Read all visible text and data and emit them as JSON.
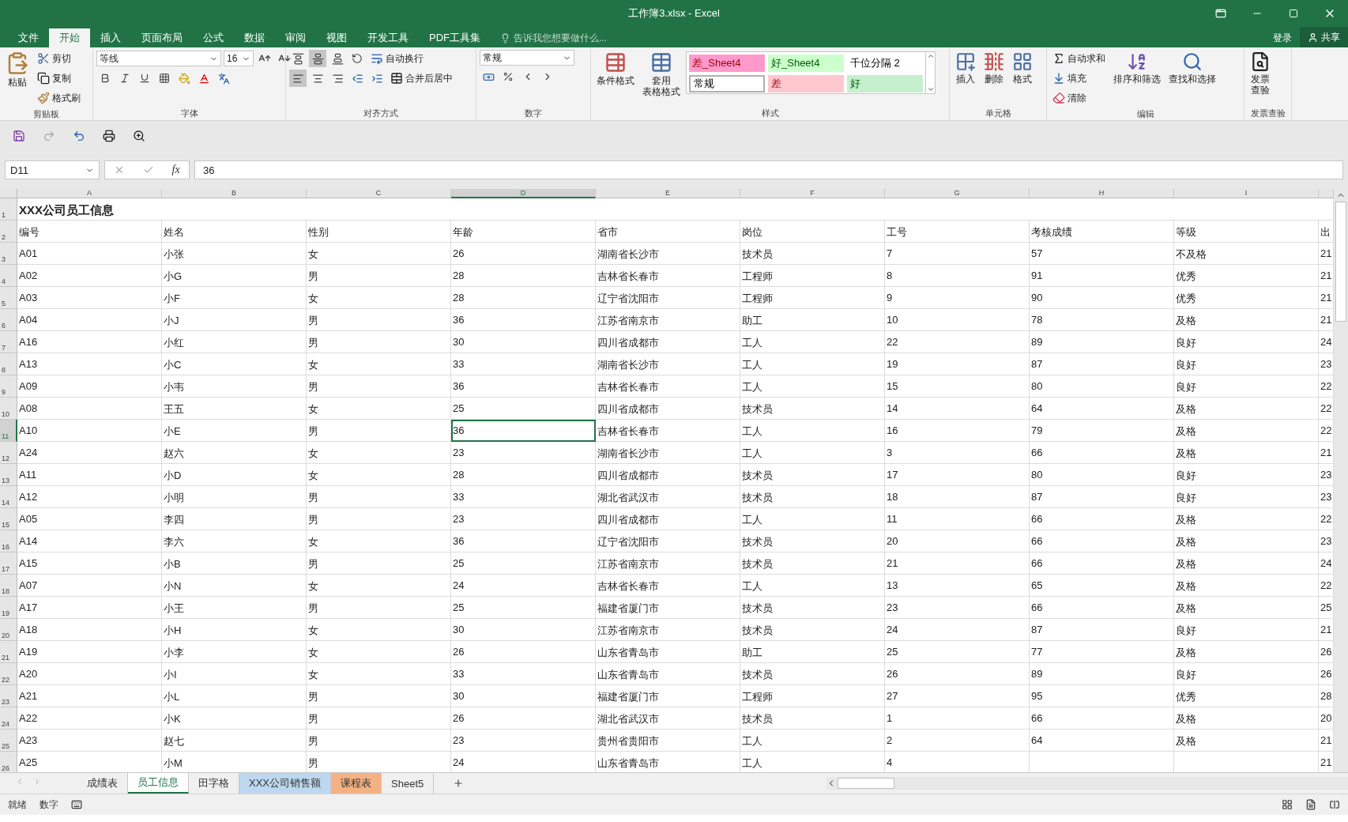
{
  "window": {
    "title": "工作簿3.xlsx - Excel"
  },
  "tabs": [
    {
      "label": "文件",
      "selected": false
    },
    {
      "label": "开始",
      "selected": true
    },
    {
      "label": "插入",
      "selected": false
    },
    {
      "label": "页面布局",
      "selected": false
    },
    {
      "label": "公式",
      "selected": false
    },
    {
      "label": "数据",
      "selected": false
    },
    {
      "label": "审阅",
      "selected": false
    },
    {
      "label": "视图",
      "selected": false
    },
    {
      "label": "开发工具",
      "selected": false
    },
    {
      "label": "PDF工具集",
      "selected": false
    }
  ],
  "tell_me": {
    "placeholder": "告诉我您想要做什么..."
  },
  "account": {
    "sign_in": "登录",
    "share": "共享"
  },
  "ribbon": {
    "clipboard": {
      "label": "剪贴板",
      "paste": "粘贴",
      "cut": "剪切",
      "copy": "复制",
      "format_painter": "格式刷"
    },
    "font": {
      "label": "字体",
      "name": "等线",
      "size": "16"
    },
    "alignment": {
      "label": "对齐方式",
      "wrap": "自动换行",
      "merge": "合并后居中",
      "vertical": [
        {
          "selected": false
        },
        {
          "selected": true
        },
        {
          "selected": false
        }
      ],
      "horizontal": [
        {
          "selected": true
        },
        {
          "selected": false
        },
        {
          "selected": false
        }
      ]
    },
    "number": {
      "label": "数字",
      "format": "常规"
    },
    "styles": {
      "label": "样式",
      "conditional": "条件格式",
      "table_format": [
        "套用",
        "表格格式"
      ],
      "cells": [
        {
          "text": "差_Sheet4",
          "kind": "bad",
          "color": "#ff99cc",
          "selected": false
        },
        {
          "text": "好_Sheet4",
          "kind": "good",
          "color": "#ccffcc",
          "selected": false
        },
        {
          "text": "千位分隔 2",
          "kind": "neutral",
          "color": "#ffffff",
          "selected": false
        },
        {
          "text": "常规",
          "kind": "neutral",
          "color": "#ffffff",
          "selected": true
        },
        {
          "text": "差",
          "kind": "bad",
          "color": "#ffc7ce",
          "selected": false
        },
        {
          "text": "好",
          "kind": "good",
          "color": "#c6efce",
          "selected": false
        }
      ]
    },
    "cells": {
      "label": "单元格",
      "insert": "插入",
      "delete": "删除",
      "format": "格式"
    },
    "editing": {
      "label": "编辑",
      "autosum": "自动求和",
      "fill": "填充",
      "clear": "清除",
      "sort": "排序和筛选",
      "find": "查找和选择"
    },
    "invoice": {
      "label": "发票查验",
      "button": [
        "发票",
        "查验"
      ]
    }
  },
  "formula_bar": {
    "name_box": "D11",
    "function_label": "fx",
    "value": "36"
  },
  "columns": [
    {
      "letter": "A",
      "selected": false
    },
    {
      "letter": "B",
      "selected": false
    },
    {
      "letter": "C",
      "selected": false
    },
    {
      "letter": "D",
      "selected": true
    },
    {
      "letter": "E",
      "selected": false
    },
    {
      "letter": "F",
      "selected": false
    },
    {
      "letter": "G",
      "selected": false
    },
    {
      "letter": "H",
      "selected": false
    },
    {
      "letter": "I",
      "selected": false
    },
    {
      "selected": false
    }
  ],
  "rows": [
    {
      "number": "1",
      "kind": "title",
      "active": false,
      "cells": [
        "XXX公司员工信息"
      ]
    },
    {
      "number": "2",
      "kind": "data",
      "active": false,
      "cells": [
        "编号",
        "姓名",
        "性别",
        "年龄",
        "省市",
        "岗位",
        "工号",
        "考核成绩",
        "等级",
        "出"
      ]
    },
    {
      "number": "3",
      "kind": "data",
      "active": false,
      "cells": [
        "A01",
        "小张",
        "女",
        "26",
        "湖南省长沙市",
        "技术员",
        "7",
        "57",
        "不及格",
        "21"
      ]
    },
    {
      "number": "4",
      "kind": "data",
      "active": false,
      "cells": [
        "A02",
        "小G",
        "男",
        "28",
        "吉林省长春市",
        "工程师",
        "8",
        "91",
        "优秀",
        "21"
      ]
    },
    {
      "number": "5",
      "kind": "data",
      "active": false,
      "cells": [
        "A03",
        "小F",
        "女",
        "28",
        "辽宁省沈阳市",
        "工程师",
        "9",
        "90",
        "优秀",
        "21"
      ]
    },
    {
      "number": "6",
      "kind": "data",
      "active": false,
      "cells": [
        "A04",
        "小J",
        "男",
        "36",
        "江苏省南京市",
        "助工",
        "10",
        "78",
        "及格",
        "21"
      ]
    },
    {
      "number": "7",
      "kind": "data",
      "active": false,
      "cells": [
        "A16",
        "小红",
        "男",
        "30",
        "四川省成都市",
        "工人",
        "22",
        "89",
        "良好",
        "24"
      ]
    },
    {
      "number": "8",
      "kind": "data",
      "active": false,
      "cells": [
        "A13",
        "小C",
        "女",
        "33",
        "湖南省长沙市",
        "工人",
        "19",
        "87",
        "良好",
        "23"
      ]
    },
    {
      "number": "9",
      "kind": "data",
      "active": false,
      "cells": [
        "A09",
        "小韦",
        "男",
        "36",
        "吉林省长春市",
        "工人",
        "15",
        "80",
        "良好",
        "22"
      ]
    },
    {
      "number": "10",
      "kind": "data",
      "active": false,
      "cells": [
        "A08",
        "王五",
        "女",
        "25",
        "四川省成都市",
        "技术员",
        "14",
        "64",
        "及格",
        "22"
      ]
    },
    {
      "number": "11",
      "kind": "data",
      "active": true,
      "cells": [
        "A10",
        "小E",
        "男",
        "36",
        "吉林省长春市",
        "工人",
        "16",
        "79",
        "及格",
        "22"
      ]
    },
    {
      "number": "12",
      "kind": "data",
      "active": false,
      "cells": [
        "A24",
        "赵六",
        "女",
        "23",
        "湖南省长沙市",
        "工人",
        "3",
        "66",
        "及格",
        "21"
      ]
    },
    {
      "number": "13",
      "kind": "data",
      "active": false,
      "cells": [
        "A11",
        "小D",
        "女",
        "28",
        "四川省成都市",
        "技术员",
        "17",
        "80",
        "良好",
        "23"
      ]
    },
    {
      "number": "14",
      "kind": "data",
      "active": false,
      "cells": [
        "A12",
        "小明",
        "男",
        "33",
        "湖北省武汉市",
        "技术员",
        "18",
        "87",
        "良好",
        "23"
      ]
    },
    {
      "number": "15",
      "kind": "data",
      "active": false,
      "cells": [
        "A05",
        "李四",
        "男",
        "23",
        "四川省成都市",
        "工人",
        "11",
        "66",
        "及格",
        "22"
      ]
    },
    {
      "number": "16",
      "kind": "data",
      "active": false,
      "cells": [
        "A14",
        "李六",
        "女",
        "36",
        "辽宁省沈阳市",
        "技术员",
        "20",
        "66",
        "及格",
        "23"
      ]
    },
    {
      "number": "17",
      "kind": "data",
      "active": false,
      "cells": [
        "A15",
        "小B",
        "男",
        "25",
        "江苏省南京市",
        "技术员",
        "21",
        "66",
        "及格",
        "24"
      ]
    },
    {
      "number": "18",
      "kind": "data",
      "active": false,
      "cells": [
        "A07",
        "小N",
        "女",
        "24",
        "吉林省长春市",
        "工人",
        "13",
        "65",
        "及格",
        "22"
      ]
    },
    {
      "number": "19",
      "kind": "data",
      "active": false,
      "cells": [
        "A17",
        "小王",
        "男",
        "25",
        "福建省厦门市",
        "技术员",
        "23",
        "66",
        "及格",
        "25"
      ]
    },
    {
      "number": "20",
      "kind": "data",
      "active": false,
      "cells": [
        "A18",
        "小H",
        "女",
        "30",
        "江苏省南京市",
        "技术员",
        "24",
        "87",
        "良好",
        "21"
      ]
    },
    {
      "number": "21",
      "kind": "data",
      "active": false,
      "cells": [
        "A19",
        "小李",
        "女",
        "26",
        "山东省青岛市",
        "助工",
        "25",
        "77",
        "及格",
        "26"
      ]
    },
    {
      "number": "22",
      "kind": "data",
      "active": false,
      "cells": [
        "A20",
        "小I",
        "女",
        "33",
        "山东省青岛市",
        "技术员",
        "26",
        "89",
        "良好",
        "26"
      ]
    },
    {
      "number": "23",
      "kind": "data",
      "active": false,
      "cells": [
        "A21",
        "小L",
        "男",
        "30",
        "福建省厦门市",
        "工程师",
        "27",
        "95",
        "优秀",
        "28"
      ]
    },
    {
      "number": "24",
      "kind": "data",
      "active": false,
      "cells": [
        "A22",
        "小K",
        "男",
        "26",
        "湖北省武汉市",
        "技术员",
        "1",
        "66",
        "及格",
        "20"
      ]
    },
    {
      "number": "25",
      "kind": "data",
      "active": false,
      "cells": [
        "A23",
        "赵七",
        "男",
        "23",
        "贵州省贵阳市",
        "工人",
        "2",
        "64",
        "及格",
        "21"
      ]
    },
    {
      "number": "26",
      "kind": "data",
      "active": false,
      "cells": [
        "A25",
        "小M",
        "男",
        "24",
        "山东省青岛市",
        "工人",
        "4",
        null,
        null,
        "21"
      ]
    }
  ],
  "sheet_tabs": [
    {
      "label": "成绩表",
      "selected": false
    },
    {
      "label": "员工信息",
      "selected": true
    },
    {
      "label": "田字格",
      "selected": false
    },
    {
      "label": "XXX公司销售额",
      "selected": false,
      "color": "#bdd7ee"
    },
    {
      "label": "课程表",
      "selected": false,
      "color": "#f4b183"
    },
    {
      "label": "Sheet5",
      "selected": false
    }
  ],
  "status_bar": {
    "ready": "就绪",
    "mode": "数字"
  }
}
